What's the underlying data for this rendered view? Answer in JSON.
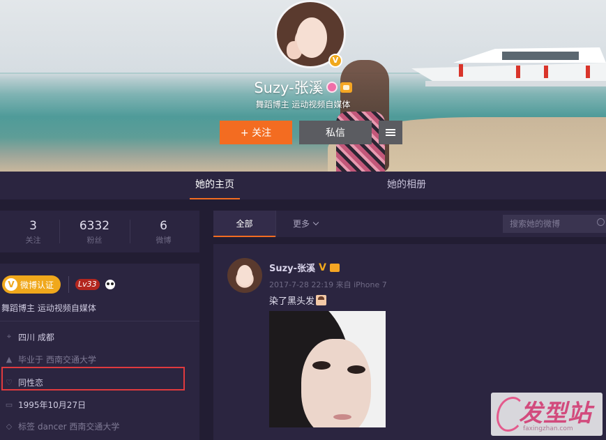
{
  "profile": {
    "name": "Suzy-张溪",
    "description": "舞蹈博主 运动视频自媒体",
    "verified_mark": "V",
    "icons": [
      "avatar",
      "verified-v-icon",
      "pink-badge-icon",
      "crown-icon"
    ],
    "buttons": {
      "follow": "+ 关注",
      "message": "私信",
      "menu_icon": "hamburger-menu-icon"
    }
  },
  "tabs": {
    "home": "她的主页",
    "album": "她的相册"
  },
  "stats": [
    {
      "value": "3",
      "label": "关注"
    },
    {
      "value": "6332",
      "label": "粉丝"
    },
    {
      "value": "6",
      "label": "微博"
    }
  ],
  "info": {
    "verify_badge": "微博认证",
    "verify_mark": "V",
    "level": "Lv33",
    "description": "舞蹈博主 运动视频自媒体",
    "rows": [
      {
        "icon": "location-icon",
        "text": "四川 成都"
      },
      {
        "icon": "graduation-cap-icon",
        "prefix": "毕业于",
        "text": "西南交通大学"
      },
      {
        "icon": "heart-icon",
        "text": "同性恋"
      },
      {
        "icon": "cake-icon",
        "text": "1995年10月27日"
      },
      {
        "icon": "tag-icon",
        "prefix": "标签",
        "text": "dancer 西南交通大学"
      }
    ]
  },
  "feed": {
    "tab_all": "全部",
    "tab_more": "更多",
    "search_placeholder": "搜索她的微博"
  },
  "post": {
    "author": "Suzy-张溪",
    "verified_mark": "V",
    "meta": "2017-7-28 22:19 来自 iPhone 7",
    "text": "染了黑头发"
  },
  "watermark": {
    "text": "发型站",
    "url": "faxingzhan.com"
  },
  "colors": {
    "page_bg": "#221d33",
    "card_bg": "#2b2540",
    "accent_orange": "#f36c21",
    "verified_gold": "#f0a81c",
    "highlight_red": "#e03a3e",
    "level_red": "#b3261e"
  }
}
